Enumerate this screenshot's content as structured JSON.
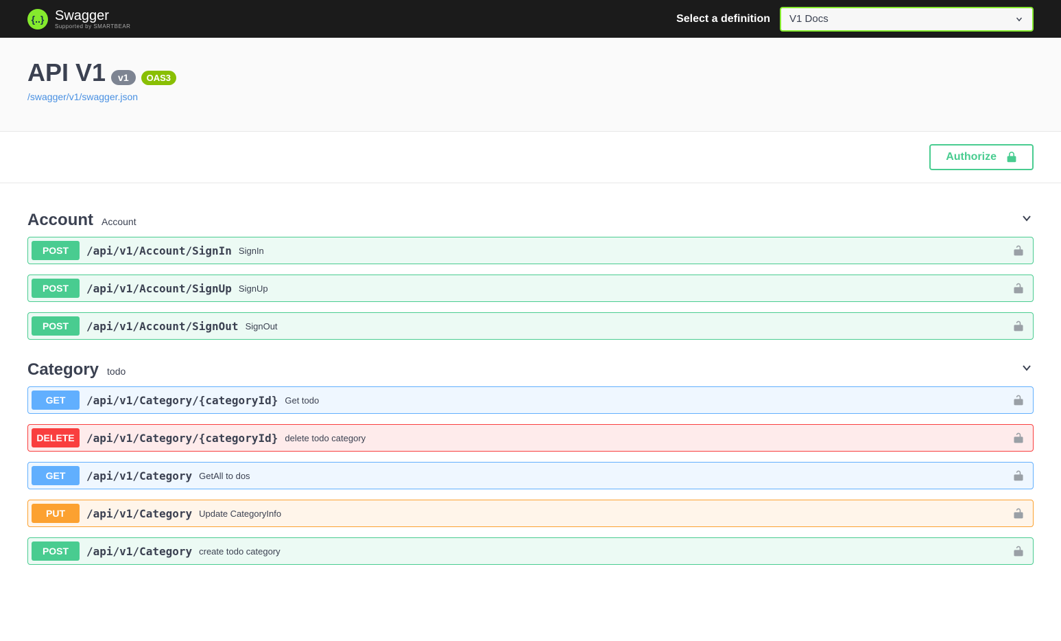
{
  "topbar": {
    "brand": "Swagger",
    "brand_sub": "Supported by SMARTBEAR",
    "select_label": "Select a definition",
    "select_value": "V1 Docs"
  },
  "info": {
    "title": "API V1",
    "version_badge": "v1",
    "oas_badge": "OAS3",
    "spec_link": "/swagger/v1/swagger.json"
  },
  "authorize_label": "Authorize",
  "tags": [
    {
      "name": "Account",
      "description": "Account",
      "ops": [
        {
          "method": "POST",
          "method_cls": "post",
          "path": "/api/v1/Account/SignIn",
          "summary": "SignIn"
        },
        {
          "method": "POST",
          "method_cls": "post",
          "path": "/api/v1/Account/SignUp",
          "summary": "SignUp"
        },
        {
          "method": "POST",
          "method_cls": "post",
          "path": "/api/v1/Account/SignOut",
          "summary": "SignOut"
        }
      ]
    },
    {
      "name": "Category",
      "description": "todo",
      "ops": [
        {
          "method": "GET",
          "method_cls": "get",
          "path": "/api/v1/Category/{categoryId}",
          "summary": "Get todo"
        },
        {
          "method": "DELETE",
          "method_cls": "delete",
          "path": "/api/v1/Category/{categoryId}",
          "summary": "delete todo category"
        },
        {
          "method": "GET",
          "method_cls": "get",
          "path": "/api/v1/Category",
          "summary": "GetAll to dos"
        },
        {
          "method": "PUT",
          "method_cls": "put",
          "path": "/api/v1/Category",
          "summary": "Update CategoryInfo"
        },
        {
          "method": "POST",
          "method_cls": "post",
          "path": "/api/v1/Category",
          "summary": "create todo category"
        }
      ]
    }
  ]
}
